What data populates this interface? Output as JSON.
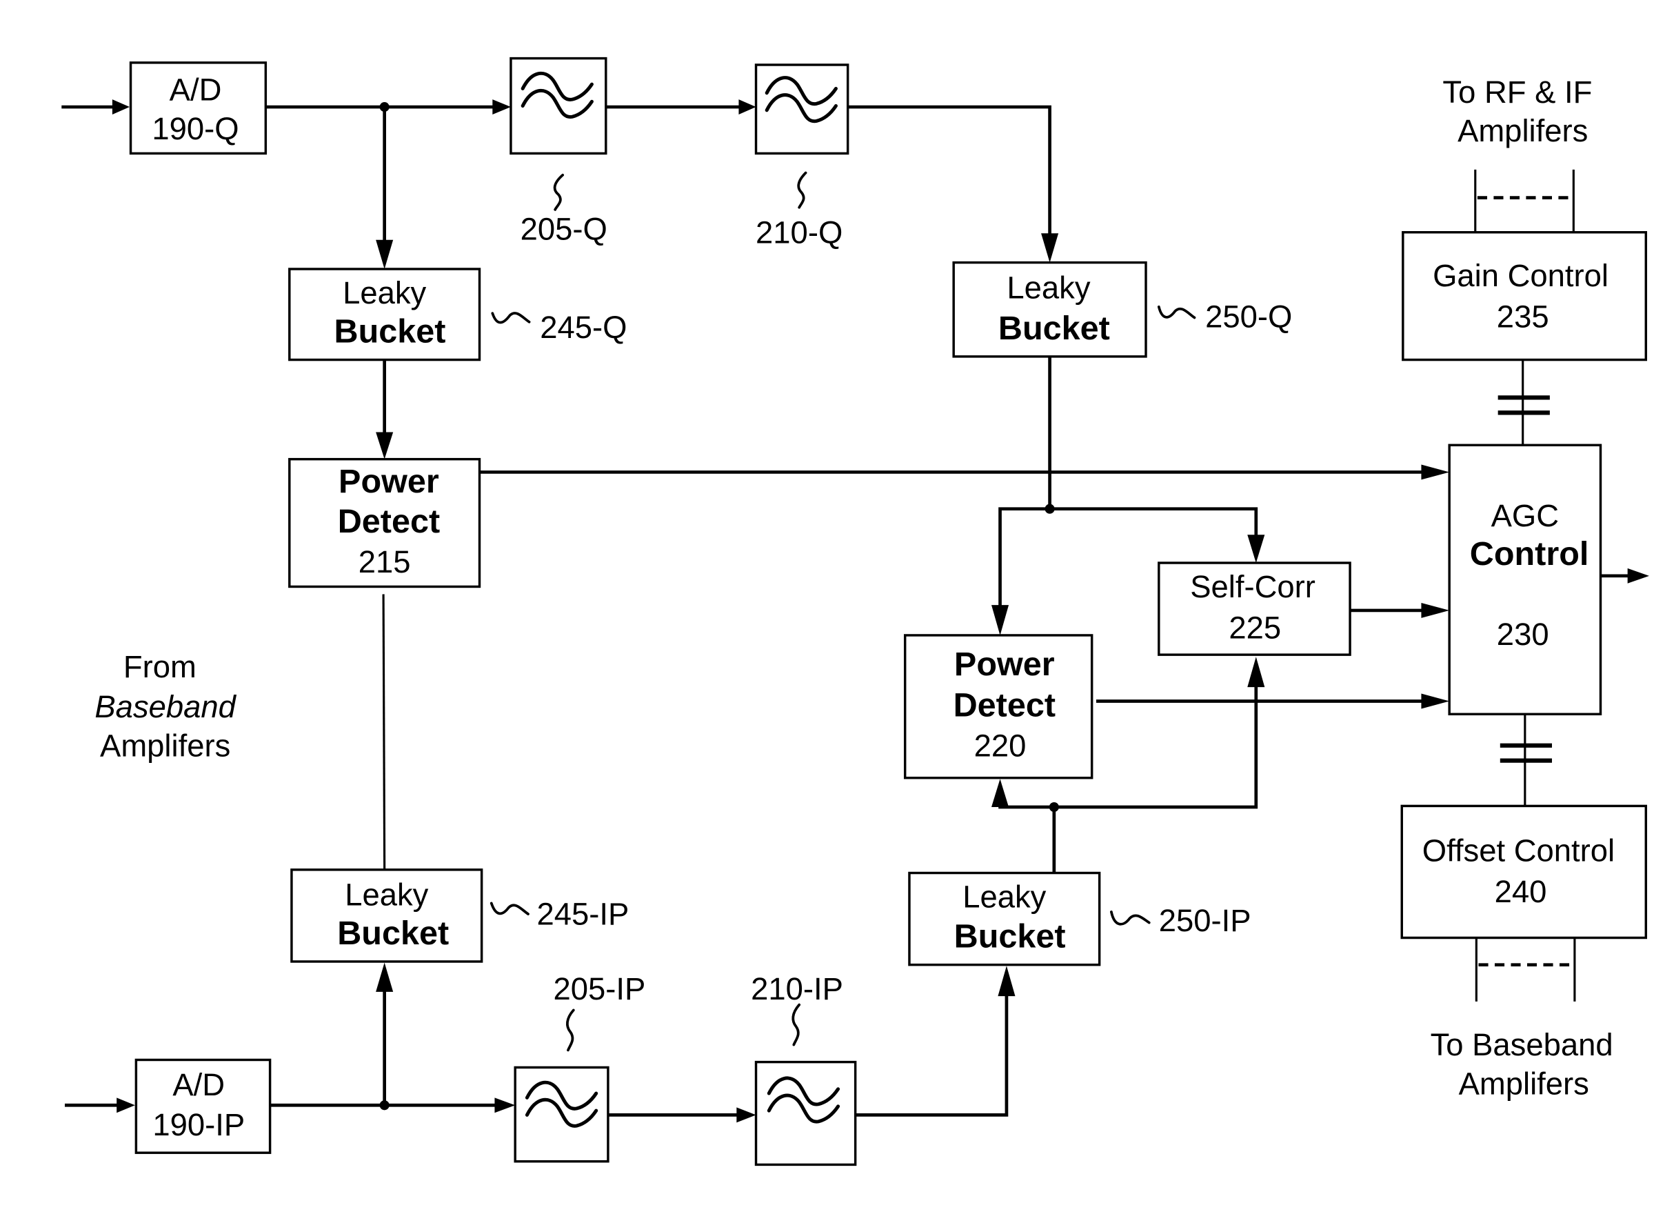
{
  "diagram": {
    "blocks": {
      "ad_q": {
        "line1": "A/D",
        "line2": "190-Q"
      },
      "ad_ip": {
        "line1": "A/D",
        "line2": "190-IP"
      },
      "lb_245q": {
        "line1": "Leaky",
        "line2": "Bucket",
        "ref": "245-Q"
      },
      "lb_250q": {
        "line1": "Leaky",
        "line2": "Bucket",
        "ref": "250-Q"
      },
      "lb_245ip": {
        "line1": "Leaky",
        "line2": "Bucket",
        "ref": "245-IP"
      },
      "lb_250ip": {
        "line1": "Leaky",
        "line2": "Bucket",
        "ref": "250-IP"
      },
      "pd_215": {
        "line1": "Power",
        "line2": "Detect",
        "line3": "215"
      },
      "pd_220": {
        "line1": "Power",
        "line2": "Detect",
        "line3": "220"
      },
      "selfcorr_225": {
        "line1": "Self-Corr",
        "line2": "225"
      },
      "agc_230": {
        "line1": "AGC",
        "line2": "Control",
        "line3": "230"
      },
      "gain_235": {
        "line1": "Gain Control",
        "line2": "235"
      },
      "offset_240": {
        "line1": "Offset Control",
        "line2": "240"
      }
    },
    "filters": {
      "f_205q": {
        "ref": "205-Q",
        "icon": "lowpass-filter-icon"
      },
      "f_210q": {
        "ref": "210-Q",
        "icon": "lowpass-filter-icon"
      },
      "f_205ip": {
        "ref": "205-IP",
        "icon": "lowpass-filter-icon"
      },
      "f_210ip": {
        "ref": "210-IP",
        "icon": "lowpass-filter-icon"
      }
    },
    "annotations": {
      "to_rf_if": {
        "line1": "To RF & IF",
        "line2": "Amplifers"
      },
      "to_baseband": {
        "line1": "To Baseband",
        "line2": "Amplifers"
      },
      "from_baseband": {
        "line1": "From",
        "line2": "Baseband",
        "line3": "Amplifers"
      }
    }
  }
}
